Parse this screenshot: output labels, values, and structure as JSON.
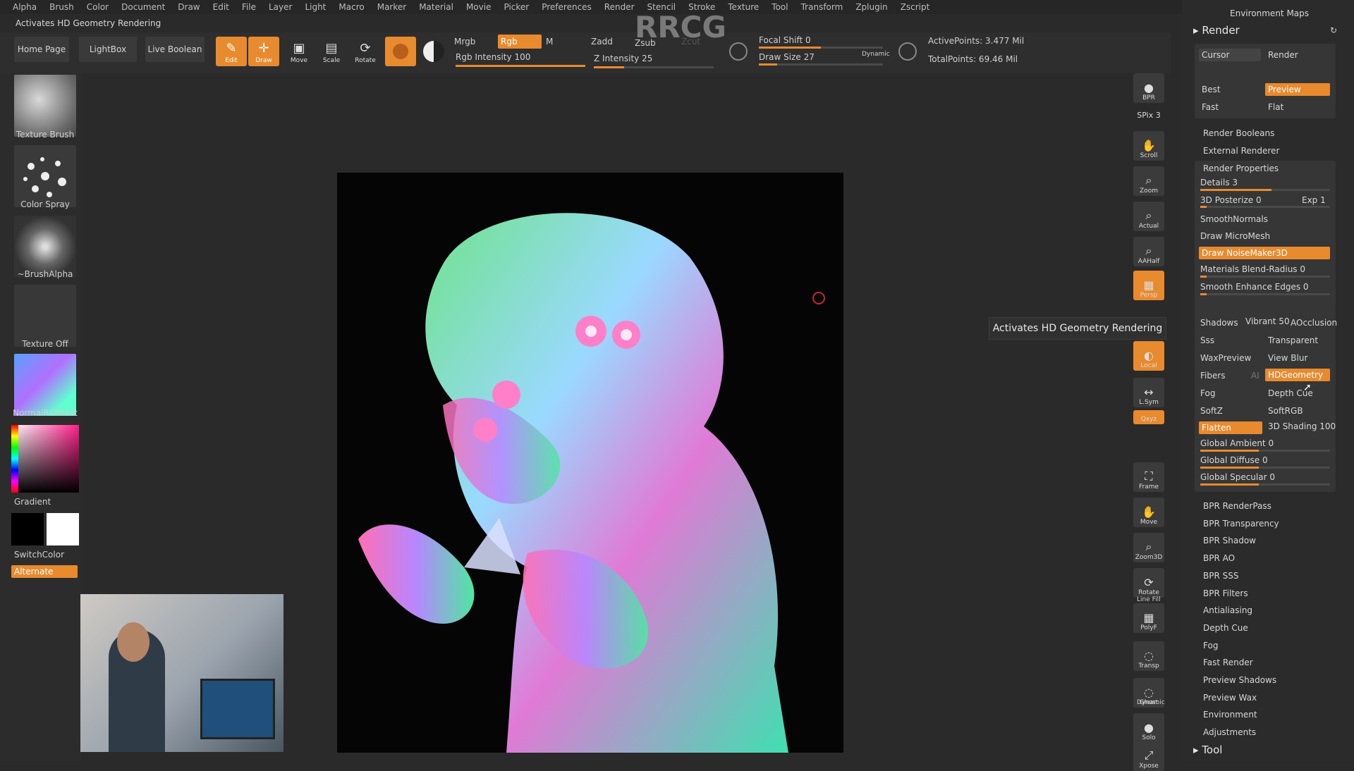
{
  "menu": [
    "Alpha",
    "Brush",
    "Color",
    "Document",
    "Draw",
    "Edit",
    "File",
    "Layer",
    "Light",
    "Macro",
    "Marker",
    "Material",
    "Movie",
    "Picker",
    "Preferences",
    "Render",
    "Stencil",
    "Stroke",
    "Texture",
    "Tool",
    "Transform",
    "Zplugin",
    "Zscript"
  ],
  "status_text": "Activates HD Geometry Rendering",
  "watermark": "RRCG",
  "nav": {
    "home": "Home Page",
    "lightbox": "LightBox",
    "live_boolean": "Live Boolean"
  },
  "tools": {
    "edit": "Edit",
    "draw": "Draw",
    "move": "Move",
    "scale": "Scale",
    "rotate": "Rotate"
  },
  "color_modes": {
    "mrgb": "Mrgb",
    "rgb": "Rgb",
    "m": "M",
    "rgb_intensity_label": "Rgb Intensity",
    "rgb_intensity": "100"
  },
  "z_modes": {
    "zadd": "Zadd",
    "zsub": "Zsub",
    "zcut": "Zcut",
    "z_intensity_label": "Z Intensity",
    "z_intensity": "25"
  },
  "focal": {
    "focal_shift_label": "Focal Shift",
    "focal_shift": "0",
    "draw_size_label": "Draw Size",
    "draw_size": "27",
    "dynamic": "Dynamic"
  },
  "points": {
    "active": "ActivePoints: 3.477 Mil",
    "total": "TotalPoints: 69.46 Mil"
  },
  "left": {
    "texture_brush": "Texture Brush",
    "color_spray": "Color Spray",
    "brush_alpha": "~BrushAlpha",
    "texture_off": "Texture Off",
    "material": "NormalRGBMat",
    "gradient": "Gradient",
    "switch_color": "SwitchColor",
    "alternate": "Alternate"
  },
  "shelf": [
    {
      "id": "bpr",
      "label": "BPR"
    },
    {
      "id": "spix",
      "label": "SPix 3"
    },
    {
      "id": "scroll",
      "label": "Scroll"
    },
    {
      "id": "zoom",
      "label": "Zoom"
    },
    {
      "id": "actual",
      "label": "Actual"
    },
    {
      "id": "aahalf",
      "label": "AAHalf"
    },
    {
      "id": "persp",
      "label": "Persp"
    },
    {
      "id": "local",
      "label": "Local"
    },
    {
      "id": "lsym",
      "label": "L.Sym"
    },
    {
      "id": "xyz",
      "label": "Qxyz"
    },
    {
      "id": "frame",
      "label": "Frame"
    },
    {
      "id": "move",
      "label": "Move"
    },
    {
      "id": "zoom3d",
      "label": "Zoom3D"
    },
    {
      "id": "rotate",
      "label": "Rotate"
    },
    {
      "id": "polyf",
      "label": "PolyF"
    },
    {
      "id": "transp",
      "label": "Transp"
    },
    {
      "id": "ghost",
      "label": "Ghost"
    },
    {
      "id": "solo",
      "label": "Solo"
    },
    {
      "id": "xpose",
      "label": "Xpose"
    }
  ],
  "shelf_extra": {
    "linefill": "Line Fill",
    "dynamic": "Dynamic"
  },
  "tooltip": "Activates HD Geometry Rendering",
  "palette": {
    "env_maps": "Environment Maps",
    "render_title": "Render",
    "cursor": "Cursor",
    "render": "Render",
    "best": "Best",
    "preview": "Preview",
    "fast": "Fast",
    "flat": "Flat",
    "render_booleans": "Render Booleans",
    "external_renderer": "External Renderer",
    "render_properties": "Render Properties",
    "details": "Details 3",
    "posterize": "3D Posterize 0",
    "exp": "Exp 1",
    "smooth_normals": "SmoothNormals",
    "draw_micromesh": "Draw MicroMesh",
    "draw_noisemaker": "Draw NoiseMaker3D",
    "materials_blend": "Materials Blend-Radius 0",
    "smooth_enhance": "Smooth Enhance Edges 0",
    "shadows": "Shadows",
    "vibrant": "Vibrant 50",
    "aocclusion": "AOcclusion",
    "sss": "Sss",
    "transparent": "Transparent",
    "waxpreview": "WaxPreview",
    "viewblur": "View Blur",
    "fibers": "Fibers",
    "ai": "AI",
    "hdgeometry": "HDGeometry",
    "fog": "Fog",
    "depthcue": "Depth Cue",
    "softz": "SoftZ",
    "softrgb": "SoftRGB",
    "flatten": "Flatten",
    "shading3d": "3D Shading 100",
    "ambient": "Global Ambient 0",
    "diffuse": "Global Diffuse 0",
    "specular": "Global Specular 0",
    "bpr_items": [
      "BPR RenderPass",
      "BPR Transparency",
      "BPR Shadow",
      "BPR AO",
      "BPR SSS",
      "BPR Filters",
      "Antialiasing",
      "Depth Cue",
      "Fog",
      "Fast Render",
      "Preview Shadows",
      "Preview Wax",
      "Environment",
      "Adjustments"
    ],
    "tool_title": "Tool"
  },
  "colors": {
    "accent": "#e88a2e",
    "bg": "#2a2a2a"
  }
}
